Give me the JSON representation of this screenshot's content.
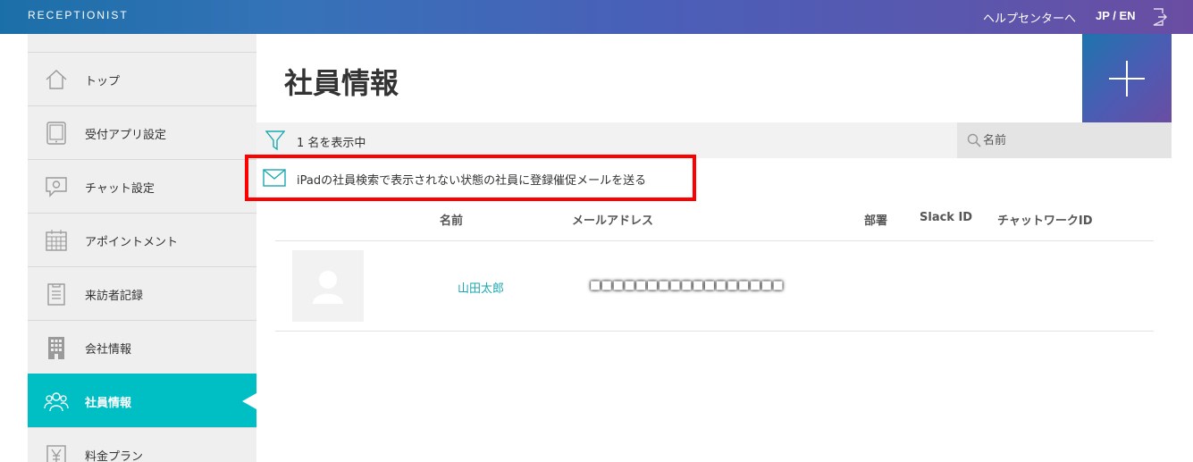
{
  "header": {
    "brand": "RECEPTIONIST",
    "help_label": "ヘルプセンターへ",
    "lang_label": "JP / EN",
    "logout_icon": "logout-icon"
  },
  "sidebar": {
    "items": [
      {
        "label": "トップ",
        "icon": "home-icon"
      },
      {
        "label": "受付アプリ設定",
        "icon": "tablet-icon"
      },
      {
        "label": "チャット設定",
        "icon": "chat-gear-icon"
      },
      {
        "label": "アポイントメント",
        "icon": "calendar-icon"
      },
      {
        "label": "来訪者記録",
        "icon": "clipboard-icon"
      },
      {
        "label": "会社情報",
        "icon": "building-icon"
      },
      {
        "label": "社員情報",
        "icon": "people-icon",
        "active": true
      },
      {
        "label": "料金プラン",
        "icon": "yen-icon"
      }
    ],
    "active_color": "#00bfc4"
  },
  "main": {
    "title": "社員情報",
    "add_icon": "plus-icon",
    "count_text": "1 名を表示中",
    "search_placeholder": "名前",
    "notify_link": "iPadの社員検索で表示されない状態の社員に登録催促メールを送る",
    "columns": [
      "名前",
      "メールアドレス",
      "部署",
      "Slack ID",
      "チャットワークID"
    ],
    "rows": [
      {
        "name": "山田太郎",
        "email": "■■■■■■■■■■■■■■■■■",
        "department": "",
        "slack_id": "",
        "chatwork_id": ""
      }
    ],
    "highlight_color": "#ff0000"
  }
}
